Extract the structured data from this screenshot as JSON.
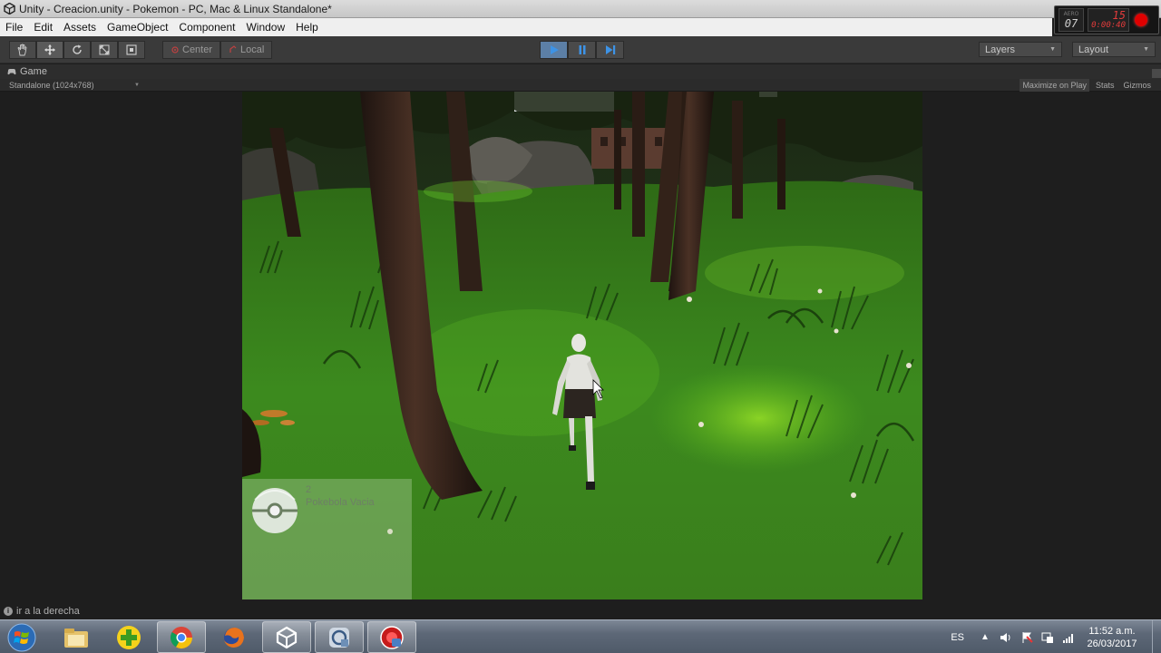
{
  "window": {
    "title": "Unity - Creacion.unity - Pokemon - PC, Mac & Linux Standalone*"
  },
  "recorder": {
    "brand": "AERO",
    "fps": "07",
    "rec_fps": "15",
    "time": "0:00:40"
  },
  "menu": {
    "items": [
      "File",
      "Edit",
      "Assets",
      "GameObject",
      "Component",
      "Window",
      "Help"
    ]
  },
  "toolbar": {
    "pivot_label": "Center",
    "space_label": "Local",
    "layers_label": "Layers",
    "layout_label": "Layout"
  },
  "game_panel": {
    "tab_label": "Game",
    "resolution": "Standalone (1024x768)",
    "maximize_label": "Maximize on Play",
    "stats_label": "Stats",
    "gizmos_label": "Gizmos"
  },
  "hud": {
    "count": "2",
    "item_name": "Pokebola Vacia"
  },
  "console": {
    "message": "ir a la derecha"
  },
  "taskbar": {
    "language": "ES",
    "time": "11:52 a.m.",
    "date": "26/03/2017"
  },
  "colors": {
    "editor_bg": "#1e1e1e",
    "toolbar_bg": "#3a3a3a",
    "play_active": "#5c7fa6",
    "grass": "#3f8a1f",
    "recorder_red": "#e00000"
  }
}
